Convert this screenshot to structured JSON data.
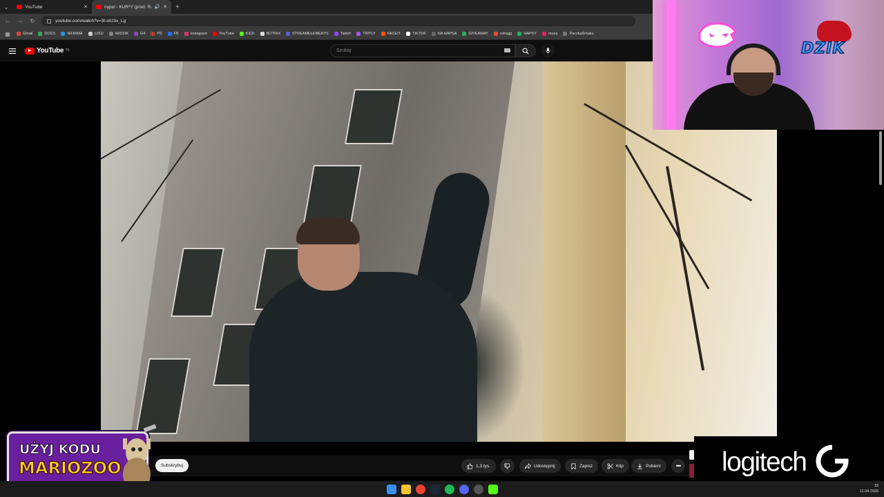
{
  "browser": {
    "tabs": [
      {
        "title": "YouTube",
        "active": false
      },
      {
        "title": "nypel - KUR*Y (prod. Raiar)",
        "active": true
      }
    ],
    "url": "youtube.com/watch?v=3t-oIU3x_Lg",
    "bookmarks": [
      {
        "label": "Gmail",
        "color": "#ea4335"
      },
      {
        "label": "DOCS",
        "color": "#34a853"
      },
      {
        "label": "WFIRMA",
        "color": "#2a8fd8"
      },
      {
        "label": "LOGI",
        "color": "#cccccc"
      },
      {
        "label": "WIDZIK",
        "color": "#888888"
      },
      {
        "label": "G4",
        "color": "#8e44ad"
      },
      {
        "label": "PS",
        "color": "#c0392b"
      },
      {
        "label": "FB",
        "color": "#1877f2"
      },
      {
        "label": "Instagram",
        "color": "#e1306c"
      },
      {
        "label": "YouTube",
        "color": "#ff0000"
      },
      {
        "label": "KICK",
        "color": "#53fc18"
      },
      {
        "label": "BOTRIX",
        "color": "#dddddd"
      },
      {
        "label": "STREAMELEMENTS",
        "color": "#5b5bd6"
      },
      {
        "label": "Twitch",
        "color": "#9146ff"
      },
      {
        "label": "TIPPLY",
        "color": "#a855f7"
      },
      {
        "label": "FACEIT",
        "color": "#ff5500"
      },
      {
        "label": "TIKTOK",
        "color": "#ffffff"
      },
      {
        "label": "NA HAPSA",
        "color": "#666666"
      },
      {
        "label": "GIVEAWAY",
        "color": "#27ae60"
      },
      {
        "label": "refragg",
        "color": "#e74c3c"
      },
      {
        "label": "HAPSY",
        "color": "#27ae60"
      },
      {
        "label": "muza",
        "color": "#e91e63"
      },
      {
        "label": "PaczkaSmaku",
        "color": "#777777"
      }
    ]
  },
  "youtube": {
    "logo_text": "YouTube",
    "region": "PL",
    "search_placeholder": "Szukaj"
  },
  "actions": {
    "likes": "1,3 tys.",
    "share": "Udostępnij",
    "save": "Zapisz",
    "clip": "Klip",
    "download": "Pobierz"
  },
  "overlay": {
    "promo_line1": "UŻYJ KODU",
    "promo_line2": "MARIOZOO",
    "subscribe": "Subskrybuj",
    "sponsor": "logitech",
    "cam_brand": "DZIK"
  },
  "taskbar": {
    "time": "18",
    "date": "11.04.2026"
  },
  "colors": {
    "youtube_red": "#ff0000",
    "promo_purple": "#6a1f9e",
    "promo_yellow": "#ffd21f",
    "dzik_blue": "#3fa4ff"
  }
}
